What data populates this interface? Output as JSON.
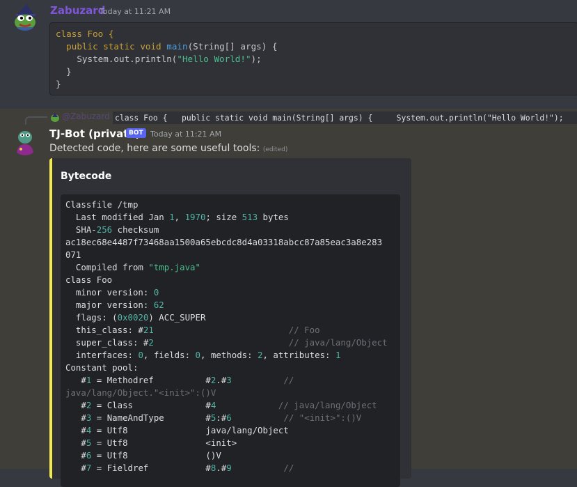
{
  "message1": {
    "username": "Zabuzard",
    "username_color": "#7f56d9",
    "timestamp": "Today at 11:21 AM",
    "code_lines": [
      [
        {
          "t": "class Foo {",
          "c": "kw"
        }
      ],
      [
        {
          "t": "  public static void ",
          "c": "kw"
        },
        {
          "t": "main",
          "c": "fn"
        },
        {
          "t": "(String[] args) {",
          "c": "dim"
        }
      ],
      [
        {
          "t": "    System.out.println(",
          "c": "dim"
        },
        {
          "t": "\"Hello World!\"",
          "c": "str"
        },
        {
          "t": ");",
          "c": "dim"
        }
      ],
      [
        {
          "t": "  }",
          "c": "dim"
        }
      ],
      [
        {
          "t": "}",
          "c": "dim"
        }
      ]
    ]
  },
  "message2": {
    "reply_username": "@Zabuzard",
    "reply_preview": "class Foo {   public static void main(String[] args) {     System.out.println(\"Hello World!\");   } }",
    "username": "TJ-Bot (private)",
    "bot_tag": "BOT",
    "timestamp": "Today at 11:21 AM",
    "content": "Detected code, here are some useful tools:",
    "edited": "(edited)",
    "embed": {
      "accent_color": "#f2e94e",
      "title": "Bytecode",
      "code_lines": [
        [
          {
            "t": "Classfile /tmp"
          }
        ],
        [
          {
            "t": "  Last modified Jan "
          },
          {
            "t": "1",
            "c": "num"
          },
          {
            "t": ", "
          },
          {
            "t": "1970",
            "c": "num"
          },
          {
            "t": "; size "
          },
          {
            "t": "513",
            "c": "num"
          },
          {
            "t": " bytes"
          }
        ],
        [
          {
            "t": "  SHA-"
          },
          {
            "t": "256",
            "c": "num"
          },
          {
            "t": " checksum"
          }
        ],
        [
          {
            "t": "ac18ec68e4487f73468aa1500a65ebcdc8d4a03318abcc87a85eac3a8e283"
          }
        ],
        [
          {
            "t": "071"
          }
        ],
        [
          {
            "t": "  Compiled from "
          },
          {
            "t": "\"tmp.java\"",
            "c": "str"
          }
        ],
        [
          {
            "t": "class Foo"
          }
        ],
        [
          {
            "t": "  minor version: "
          },
          {
            "t": "0",
            "c": "num"
          }
        ],
        [
          {
            "t": "  major version: "
          },
          {
            "t": "62",
            "c": "num"
          }
        ],
        [
          {
            "t": "  flags: ("
          },
          {
            "t": "0x0020",
            "c": "num"
          },
          {
            "t": ") ACC_SUPER"
          }
        ],
        [
          {
            "t": "  this_class: #"
          },
          {
            "t": "21",
            "c": "num"
          },
          {
            "t": "                          "
          },
          {
            "t": "// Foo",
            "c": "cm"
          }
        ],
        [
          {
            "t": "  super_class: #"
          },
          {
            "t": "2",
            "c": "num"
          },
          {
            "t": "                          "
          },
          {
            "t": "// java/lang/Object",
            "c": "cm"
          }
        ],
        [
          {
            "t": "  interfaces: "
          },
          {
            "t": "0",
            "c": "num"
          },
          {
            "t": ", fields: "
          },
          {
            "t": "0",
            "c": "num"
          },
          {
            "t": ", methods: "
          },
          {
            "t": "2",
            "c": "num"
          },
          {
            "t": ", attributes: "
          },
          {
            "t": "1",
            "c": "num"
          }
        ],
        [
          {
            "t": "Constant pool:"
          }
        ],
        [
          {
            "t": "   #"
          },
          {
            "t": "1",
            "c": "num"
          },
          {
            "t": " = Methodref          #"
          },
          {
            "t": "2",
            "c": "num"
          },
          {
            "t": ".#"
          },
          {
            "t": "3",
            "c": "num"
          },
          {
            "t": "          "
          },
          {
            "t": "//",
            "c": "cm"
          }
        ],
        [
          {
            "t": "java/lang/Object.\"<init>\":()V",
            "c": "cm"
          }
        ],
        [
          {
            "t": "   #"
          },
          {
            "t": "2",
            "c": "num"
          },
          {
            "t": " = Class              #"
          },
          {
            "t": "4",
            "c": "num"
          },
          {
            "t": "            "
          },
          {
            "t": "// java/lang/Object",
            "c": "cm"
          }
        ],
        [
          {
            "t": "   #"
          },
          {
            "t": "3",
            "c": "num"
          },
          {
            "t": " = NameAndType        #"
          },
          {
            "t": "5",
            "c": "num"
          },
          {
            "t": ":#"
          },
          {
            "t": "6",
            "c": "num"
          },
          {
            "t": "          "
          },
          {
            "t": "// \"<init>\":()V",
            "c": "cm"
          }
        ],
        [
          {
            "t": "   #"
          },
          {
            "t": "4",
            "c": "num"
          },
          {
            "t": " = Utf8               java/lang/Object"
          }
        ],
        [
          {
            "t": "   #"
          },
          {
            "t": "5",
            "c": "num"
          },
          {
            "t": " = Utf8               <init>"
          }
        ],
        [
          {
            "t": "   #"
          },
          {
            "t": "6",
            "c": "num"
          },
          {
            "t": " = Utf8               ()V"
          }
        ],
        [
          {
            "t": "   #"
          },
          {
            "t": "7",
            "c": "num"
          },
          {
            "t": " = Fieldref           #"
          },
          {
            "t": "8",
            "c": "num"
          },
          {
            "t": ".#"
          },
          {
            "t": "9",
            "c": "num"
          },
          {
            "t": "          "
          },
          {
            "t": "//",
            "c": "cm"
          }
        ]
      ]
    }
  }
}
